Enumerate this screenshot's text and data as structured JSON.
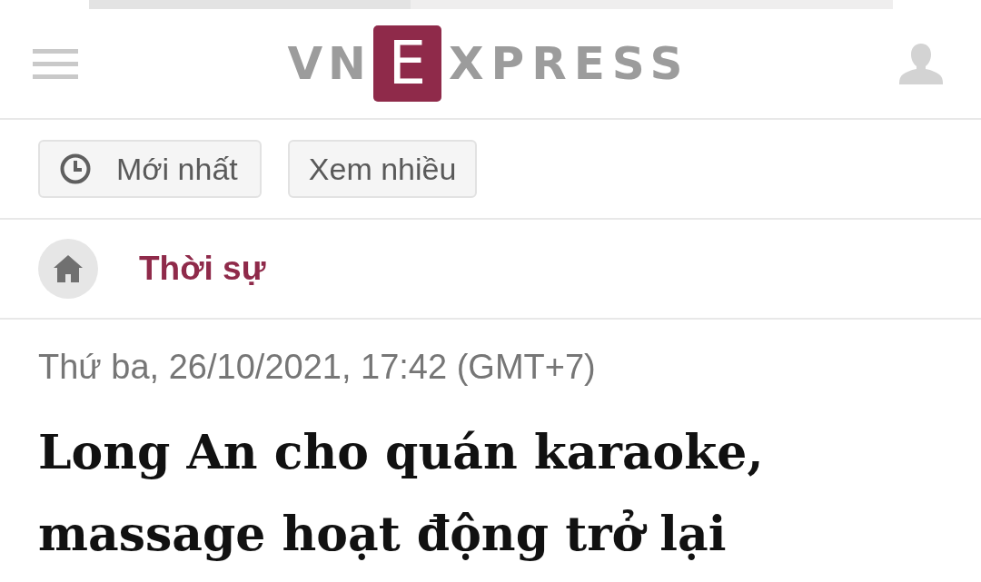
{
  "header": {
    "logo": {
      "prefix": "VN",
      "boxed_letter": "E",
      "suffix": "XPRESS"
    }
  },
  "tabs": [
    {
      "kind": "icon",
      "label": "Mới nhất"
    },
    {
      "kind": "text",
      "label": "Xem nhiều"
    }
  ],
  "breadcrumb": {
    "section": "Thời sự"
  },
  "article": {
    "date": "Thứ ba, 26/10/2021, 17:42 (GMT+7)",
    "title": "Long An cho quán karaoke, massage hoạt động trở lại"
  }
}
